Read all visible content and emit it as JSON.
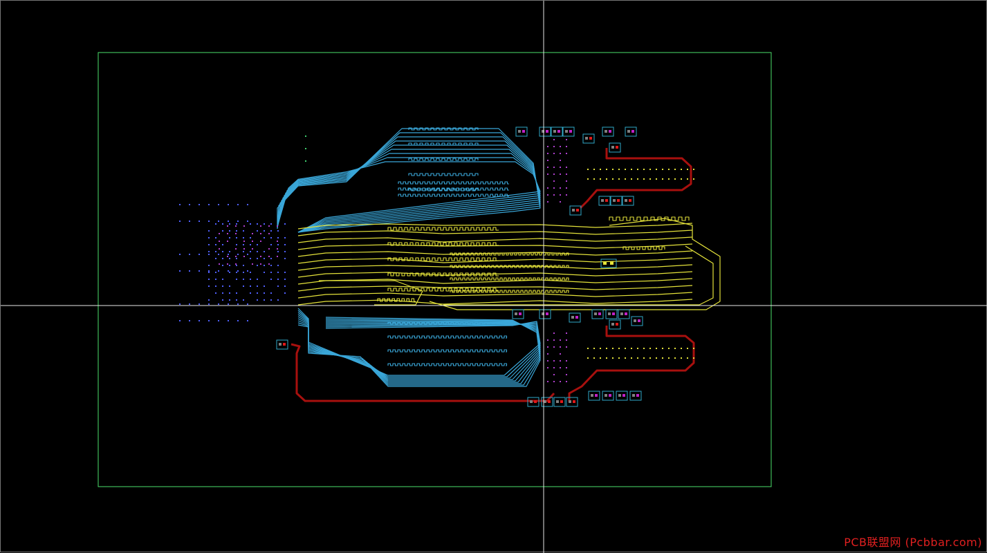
{
  "watermark": "PCB联盟网 (Pcbbar.com)",
  "colors": {
    "background": "#000000",
    "board_outline": "#4be06c",
    "crosshair": "#e8e8e8",
    "trace_top": "#3aa7d9",
    "trace_inner": "#e4e23a",
    "trace_power": "#a8100e",
    "pad": "#e01818",
    "pad_alt": "#c020c8",
    "pad_outline": "#30a8c8",
    "via_blue": "#5060ff",
    "via_violet": "#b040d0",
    "via_green": "#40d070",
    "via_yellow": "#e4e23a"
  }
}
